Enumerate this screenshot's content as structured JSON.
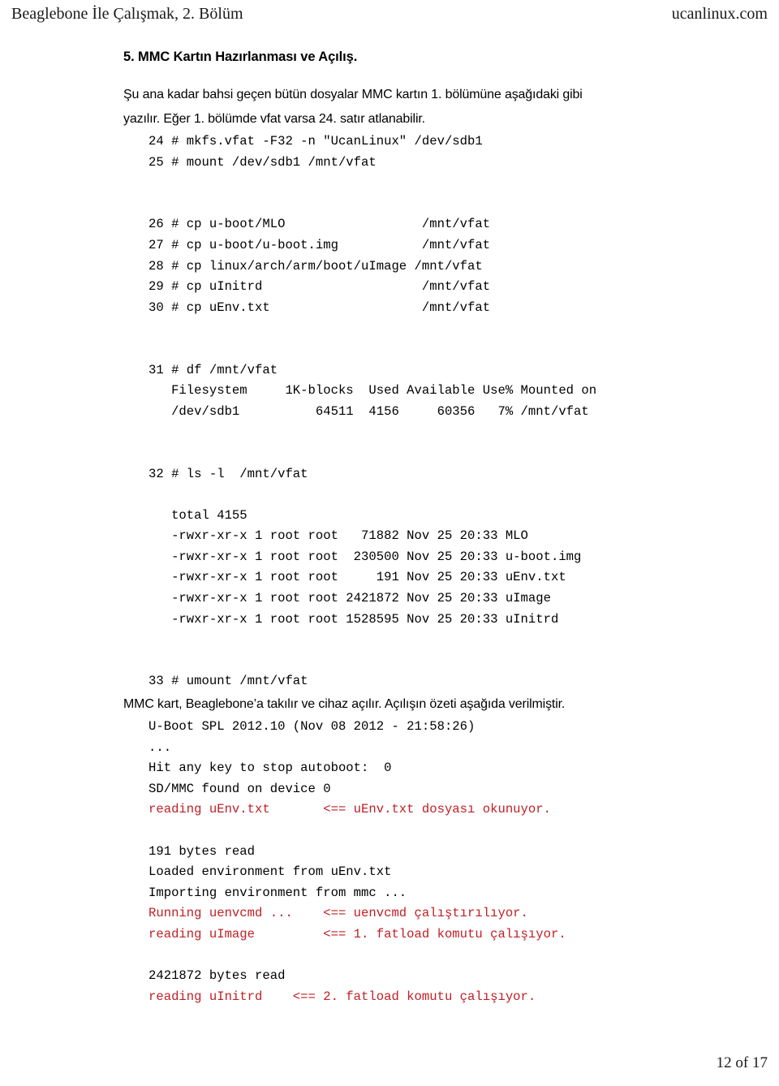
{
  "header": {
    "left": "Beaglebone İle Çalışmak, 2. Bölüm",
    "right": "ucanlinux.com"
  },
  "footer": {
    "page_label": "12 of 17"
  },
  "colors": {
    "text": "#000000",
    "annotation_red": "#bf2026",
    "header_text": "#1a1a1a"
  },
  "section": {
    "title": "5. MMC Kartın Hazırlanması ve Açılış.",
    "intro_paragraph": "Şu ana kadar bahsi geçen bütün dosyalar MMC kartın 1. bölümüne aşağıdaki gibi yazılır. Eğer 1. bölümde vfat varsa 24. satır atlanabilir.",
    "mid_paragraph": "MMC kart, Beaglebone’a takılır ve cihaz açılır. Açılışın özeti aşağıda verilmiştir."
  },
  "code_block_1": {
    "lines": [
      {
        "text": "24 # mkfs.vfat -F32 -n \"UcanLinux\" /dev/sdb1",
        "color": "black"
      },
      {
        "text": "25 # mount /dev/sdb1 /mnt/vfat",
        "color": "black"
      },
      {
        "text": "",
        "color": "black"
      },
      {
        "text": "",
        "color": "black"
      },
      {
        "text": "26 # cp u-boot/MLO                  /mnt/vfat",
        "color": "black"
      },
      {
        "text": "27 # cp u-boot/u-boot.img           /mnt/vfat",
        "color": "black"
      },
      {
        "text": "28 # cp linux/arch/arm/boot/uImage /mnt/vfat",
        "color": "black"
      },
      {
        "text": "29 # cp uInitrd                     /mnt/vfat",
        "color": "black"
      },
      {
        "text": "30 # cp uEnv.txt                    /mnt/vfat",
        "color": "black"
      },
      {
        "text": "",
        "color": "black"
      },
      {
        "text": "",
        "color": "black"
      },
      {
        "text": "31 # df /mnt/vfat",
        "color": "black"
      },
      {
        "text": "   Filesystem     1K-blocks  Used Available Use% Mounted on",
        "color": "black"
      },
      {
        "text": "   /dev/sdb1          64511  4156     60356   7% /mnt/vfat",
        "color": "black"
      },
      {
        "text": "",
        "color": "black"
      },
      {
        "text": "",
        "color": "black"
      },
      {
        "text": "32 # ls -l  /mnt/vfat",
        "color": "black"
      },
      {
        "text": "",
        "color": "black"
      },
      {
        "text": "   total 4155",
        "color": "black"
      },
      {
        "text": "   -rwxr-xr-x 1 root root   71882 Nov 25 20:33 MLO",
        "color": "black"
      },
      {
        "text": "   -rwxr-xr-x 1 root root  230500 Nov 25 20:33 u-boot.img",
        "color": "black"
      },
      {
        "text": "   -rwxr-xr-x 1 root root     191 Nov 25 20:33 uEnv.txt",
        "color": "black"
      },
      {
        "text": "   -rwxr-xr-x 1 root root 2421872 Nov 25 20:33 uImage",
        "color": "black"
      },
      {
        "text": "   -rwxr-xr-x 1 root root 1528595 Nov 25 20:33 uInitrd",
        "color": "black"
      },
      {
        "text": "",
        "color": "black"
      },
      {
        "text": "",
        "color": "black"
      },
      {
        "text": "33 # umount /mnt/vfat",
        "color": "black"
      }
    ]
  },
  "code_block_2": {
    "lines": [
      {
        "text": "U-Boot SPL 2012.10 (Nov 08 2012 - 21:58:26)",
        "color": "black"
      },
      {
        "text": "...",
        "color": "black"
      },
      {
        "text": "Hit any key to stop autoboot:  0",
        "color": "black"
      },
      {
        "text": "SD/MMC found on device 0",
        "color": "black"
      },
      {
        "text": "reading uEnv.txt       <== uEnv.txt dosyası okunuyor.",
        "color": "red"
      },
      {
        "text": "",
        "color": "black"
      },
      {
        "text": "191 bytes read",
        "color": "black"
      },
      {
        "text": "Loaded environment from uEnv.txt",
        "color": "black"
      },
      {
        "text": "Importing environment from mmc ...",
        "color": "black"
      },
      {
        "text": "Running uenvcmd ...    <== uenvcmd çalıştırılıyor.",
        "color": "red"
      },
      {
        "text": "reading uImage         <== 1. fatload komutu çalışıyor.",
        "color": "red"
      },
      {
        "text": "",
        "color": "black"
      },
      {
        "text": "2421872 bytes read",
        "color": "black"
      },
      {
        "text": "reading uInitrd    <== 2. fatload komutu çalışıyor.",
        "color": "red"
      }
    ]
  }
}
